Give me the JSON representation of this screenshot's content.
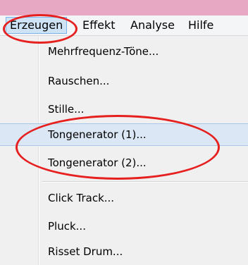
{
  "colors": {
    "annotation": "#e5201f",
    "highlight": "#dbe7f4",
    "title_strip": "#e6a8c2"
  },
  "menubar": {
    "items": [
      {
        "label": "Erzeugen"
      },
      {
        "label": "Effekt"
      },
      {
        "label": "Analyse"
      },
      {
        "label": "Hilfe"
      }
    ]
  },
  "menu": {
    "items": [
      {
        "label": "Mehrfrequenz-Töne..."
      },
      {
        "label": "Rauschen..."
      },
      {
        "label": "Stille..."
      },
      {
        "label": "Tongenerator (1)..."
      },
      {
        "label": "Tongenerator (2)..."
      },
      {
        "label": "Click Track..."
      },
      {
        "label": "Pluck..."
      },
      {
        "label": "Risset Drum..."
      }
    ],
    "highlighted": "Tongenerator (1)..."
  }
}
